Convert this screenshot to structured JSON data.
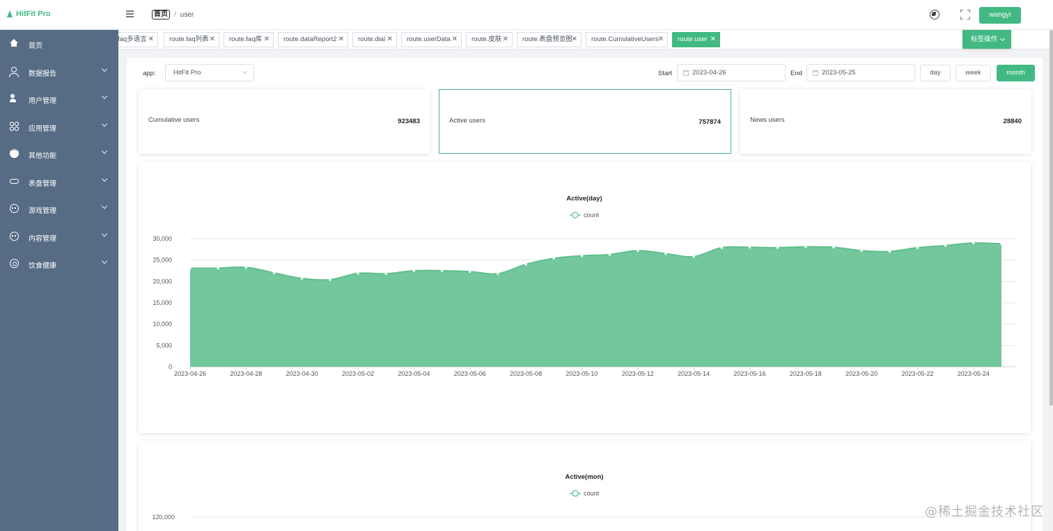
{
  "app": {
    "title": "HitFit Pro"
  },
  "breadcrumb": {
    "home": "首页",
    "current": "user"
  },
  "header": {
    "user_label": "wangyi"
  },
  "sidebar": {
    "items": [
      {
        "label": "首页",
        "icon": "home-icon",
        "has_children": false
      },
      {
        "label": "数据报告",
        "icon": "person-icon",
        "has_children": true
      },
      {
        "label": "用户管理",
        "icon": "users-icon",
        "has_children": true
      },
      {
        "label": "应用管理",
        "icon": "apps-grid-icon",
        "has_children": true
      },
      {
        "label": "其他功能",
        "icon": "more-dots-icon",
        "has_children": true
      },
      {
        "label": "表盘管理",
        "icon": "watch-icon",
        "has_children": true
      },
      {
        "label": "游戏管理",
        "icon": "gamepad-icon",
        "has_children": true
      },
      {
        "label": "内容管理",
        "icon": "gamepad-icon",
        "has_children": true
      },
      {
        "label": "饮食健康",
        "icon": "diet-icon",
        "has_children": true
      }
    ]
  },
  "tags": [
    {
      "label": "faq多语言",
      "active": false
    },
    {
      "label": "route.faq列表",
      "active": false
    },
    {
      "label": "route.faq库",
      "active": false
    },
    {
      "label": "route.dataReport2",
      "active": false
    },
    {
      "label": "route.dial",
      "active": false
    },
    {
      "label": "route.userData",
      "active": false
    },
    {
      "label": "route.皮肤",
      "active": false
    },
    {
      "label": "route.表盘预览图",
      "active": false
    },
    {
      "label": "route.CumulativeUsers",
      "active": false
    },
    {
      "label": "route.user",
      "active": true
    }
  ],
  "tag_ops_label": "标签操作",
  "filters": {
    "app_label": "app:",
    "app_value": "HitFit Pro",
    "start_label": "Start",
    "start_value": "2023-04-26",
    "end_label": "End",
    "end_value": "2023-05-25",
    "buttons": [
      {
        "label": "day",
        "active": false
      },
      {
        "label": "week",
        "active": false
      },
      {
        "label": "month",
        "active": true
      }
    ]
  },
  "stats": [
    {
      "label": "Cumulative users",
      "value": "923483",
      "selected": false
    },
    {
      "label": "Active users",
      "value": "757874",
      "selected": true
    },
    {
      "label": "News users",
      "value": "28840",
      "selected": false
    }
  ],
  "colors": {
    "accent": "#42b983",
    "sidebar": "#566c85",
    "area_fill": "#73c79c"
  },
  "watermark": "@稀土掘金技术社区",
  "chart_data": [
    {
      "type": "area",
      "title": "Active(day)",
      "legend": [
        "count"
      ],
      "legend_position": "top-center",
      "grid": true,
      "ylim": [
        0,
        30000
      ],
      "yticks": [
        "0",
        "5,000",
        "10,000",
        "15,000",
        "20,000",
        "25,000",
        "30,000"
      ],
      "x": [
        "2023-04-26",
        "2023-04-27",
        "2023-04-28",
        "2023-04-29",
        "2023-04-30",
        "2023-05-01",
        "2023-05-02",
        "2023-05-03",
        "2023-05-04",
        "2023-05-05",
        "2023-05-06",
        "2023-05-07",
        "2023-05-08",
        "2023-05-09",
        "2023-05-10",
        "2023-05-11",
        "2023-05-12",
        "2023-05-13",
        "2023-05-14",
        "2023-05-15",
        "2023-05-16",
        "2023-05-17",
        "2023-05-18",
        "2023-05-19",
        "2023-05-20",
        "2023-05-21",
        "2023-05-22",
        "2023-05-23",
        "2023-05-24",
        "2023-05-25"
      ],
      "xtick_labels": [
        "2023-04-26",
        "2023-04-28",
        "2023-04-30",
        "2023-05-02",
        "2023-05-04",
        "2023-05-06",
        "2023-05-08",
        "2023-05-10",
        "2023-05-12",
        "2023-05-14",
        "2023-05-16",
        "2023-05-18",
        "2023-05-20",
        "2023-05-22",
        "2023-05-24"
      ],
      "series": [
        {
          "name": "count",
          "values": [
            23100,
            23100,
            23300,
            22000,
            20700,
            20400,
            21900,
            21800,
            22500,
            22500,
            22300,
            21800,
            24000,
            25400,
            26000,
            26300,
            27200,
            26500,
            25800,
            27900,
            28000,
            27900,
            28100,
            28000,
            27200,
            27000,
            27900,
            28400,
            29000,
            28800
          ]
        }
      ]
    },
    {
      "type": "area",
      "title": "Active(mon)",
      "legend": [
        "count"
      ],
      "legend_position": "top-center",
      "grid": true,
      "yticks": [
        "120,000"
      ]
    }
  ]
}
